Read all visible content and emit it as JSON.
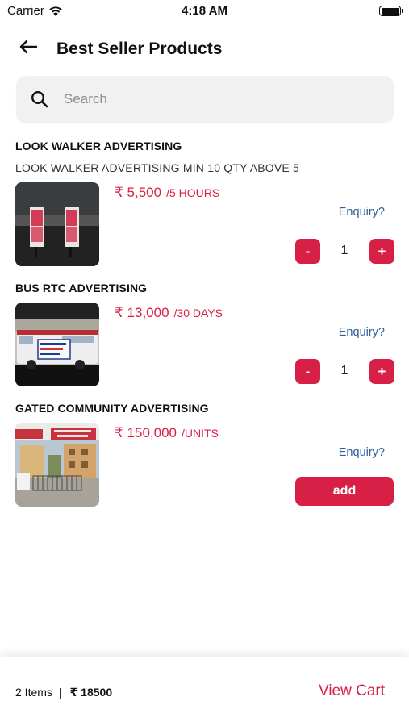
{
  "status_bar": {
    "carrier": "Carrier",
    "time": "4:18 AM"
  },
  "header": {
    "title": "Best Seller Products",
    "back_icon": "arrow-left-icon"
  },
  "search": {
    "placeholder": "Search",
    "value": ""
  },
  "products": [
    {
      "title": "LOOK WALKER ADVERTISING",
      "description": "LOOK WALKER ADVERTISING MIN 10 QTY ABOVE 5",
      "price": "₹ 5,500",
      "unit": "/5 HOURS",
      "enquiry": "Enquiry?",
      "quantity": "1",
      "minus": "-",
      "plus": "+"
    },
    {
      "title": "BUS RTC ADVERTISING",
      "price": "₹ 13,000",
      "unit": "/30 DAYS",
      "enquiry": "Enquiry?",
      "quantity": "1",
      "minus": "-",
      "plus": "+"
    },
    {
      "title": "GATED COMMUNITY ADVERTISING",
      "price": "₹ 150,000",
      "unit": "/UNITS",
      "enquiry": "Enquiry?",
      "add_label": "add"
    }
  ],
  "cart": {
    "items": "2 Items",
    "separator": "|",
    "total": "₹ 18500",
    "view_cart": "View Cart"
  },
  "colors": {
    "accent": "#d81f45",
    "link": "#2f5f99",
    "search_bg": "#f1f1f1"
  }
}
